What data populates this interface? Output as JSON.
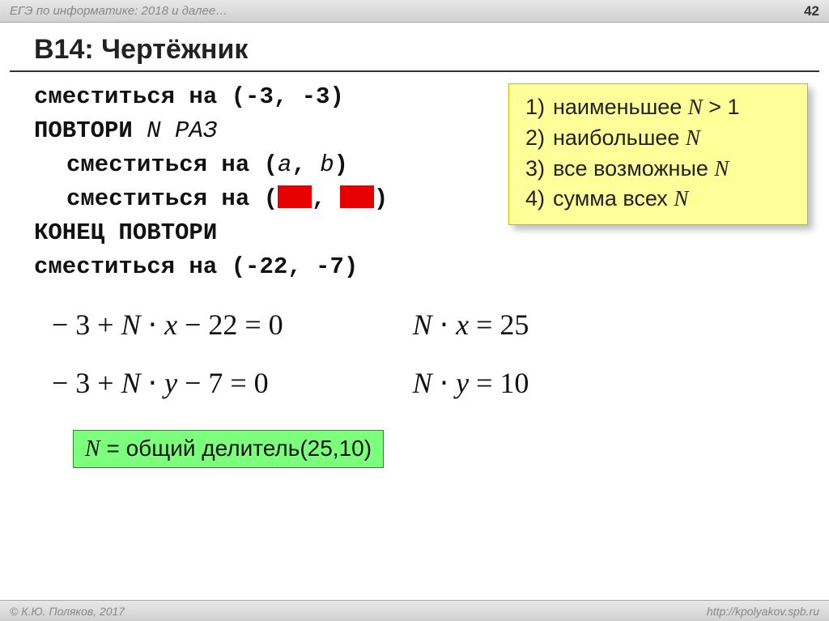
{
  "header": {
    "title": "ЕГЭ по информатике: 2018 и далее…",
    "page_number": "42"
  },
  "slide": {
    "title": "B14: Чертёжник"
  },
  "code": {
    "line1_a": "сместиться на (-3, -3)",
    "line2": "ПОВТОРИ ",
    "line2_n": "N",
    "line2_b": " РАЗ",
    "line3_a": "сместиться на (",
    "line3_b": "a",
    "line3_c": ", ",
    "line3_d": "b",
    "line3_e": ")",
    "line4_a": "сместиться на (",
    "line4_b": ", ",
    "line4_c": ")",
    "line5": "КОНЕЦ ПОВТОРИ",
    "line6": "сместиться на (-22, -7)"
  },
  "options": {
    "items": [
      {
        "num": "1)",
        "text_a": "наименьшее ",
        "text_b": " > 1"
      },
      {
        "num": "2)",
        "text_a": "наибольшее ",
        "text_b": ""
      },
      {
        "num": "3)",
        "text_a": "все возможные ",
        "text_b": ""
      },
      {
        "num": "4)",
        "text_a": "сумма всех ",
        "text_b": ""
      }
    ],
    "N": "N"
  },
  "equations": {
    "left1_a": "− 3 + ",
    "left1_b": " ⋅ ",
    "left1_c": " − 22 = 0",
    "left2_a": "− 3 + ",
    "left2_b": " ⋅ ",
    "left2_c": " − 7 = 0",
    "right1_a": " ⋅ ",
    "right1_b": " = 25",
    "right2_a": " ⋅ ",
    "right2_b": " = 10",
    "N": "N",
    "x": "x",
    "y": "y"
  },
  "result": {
    "prefix": " = общий делитель(25,10)",
    "N": "N"
  },
  "footer": {
    "left": "© К.Ю. Поляков, 2017",
    "right": "http://kpolyakov.spb.ru"
  }
}
